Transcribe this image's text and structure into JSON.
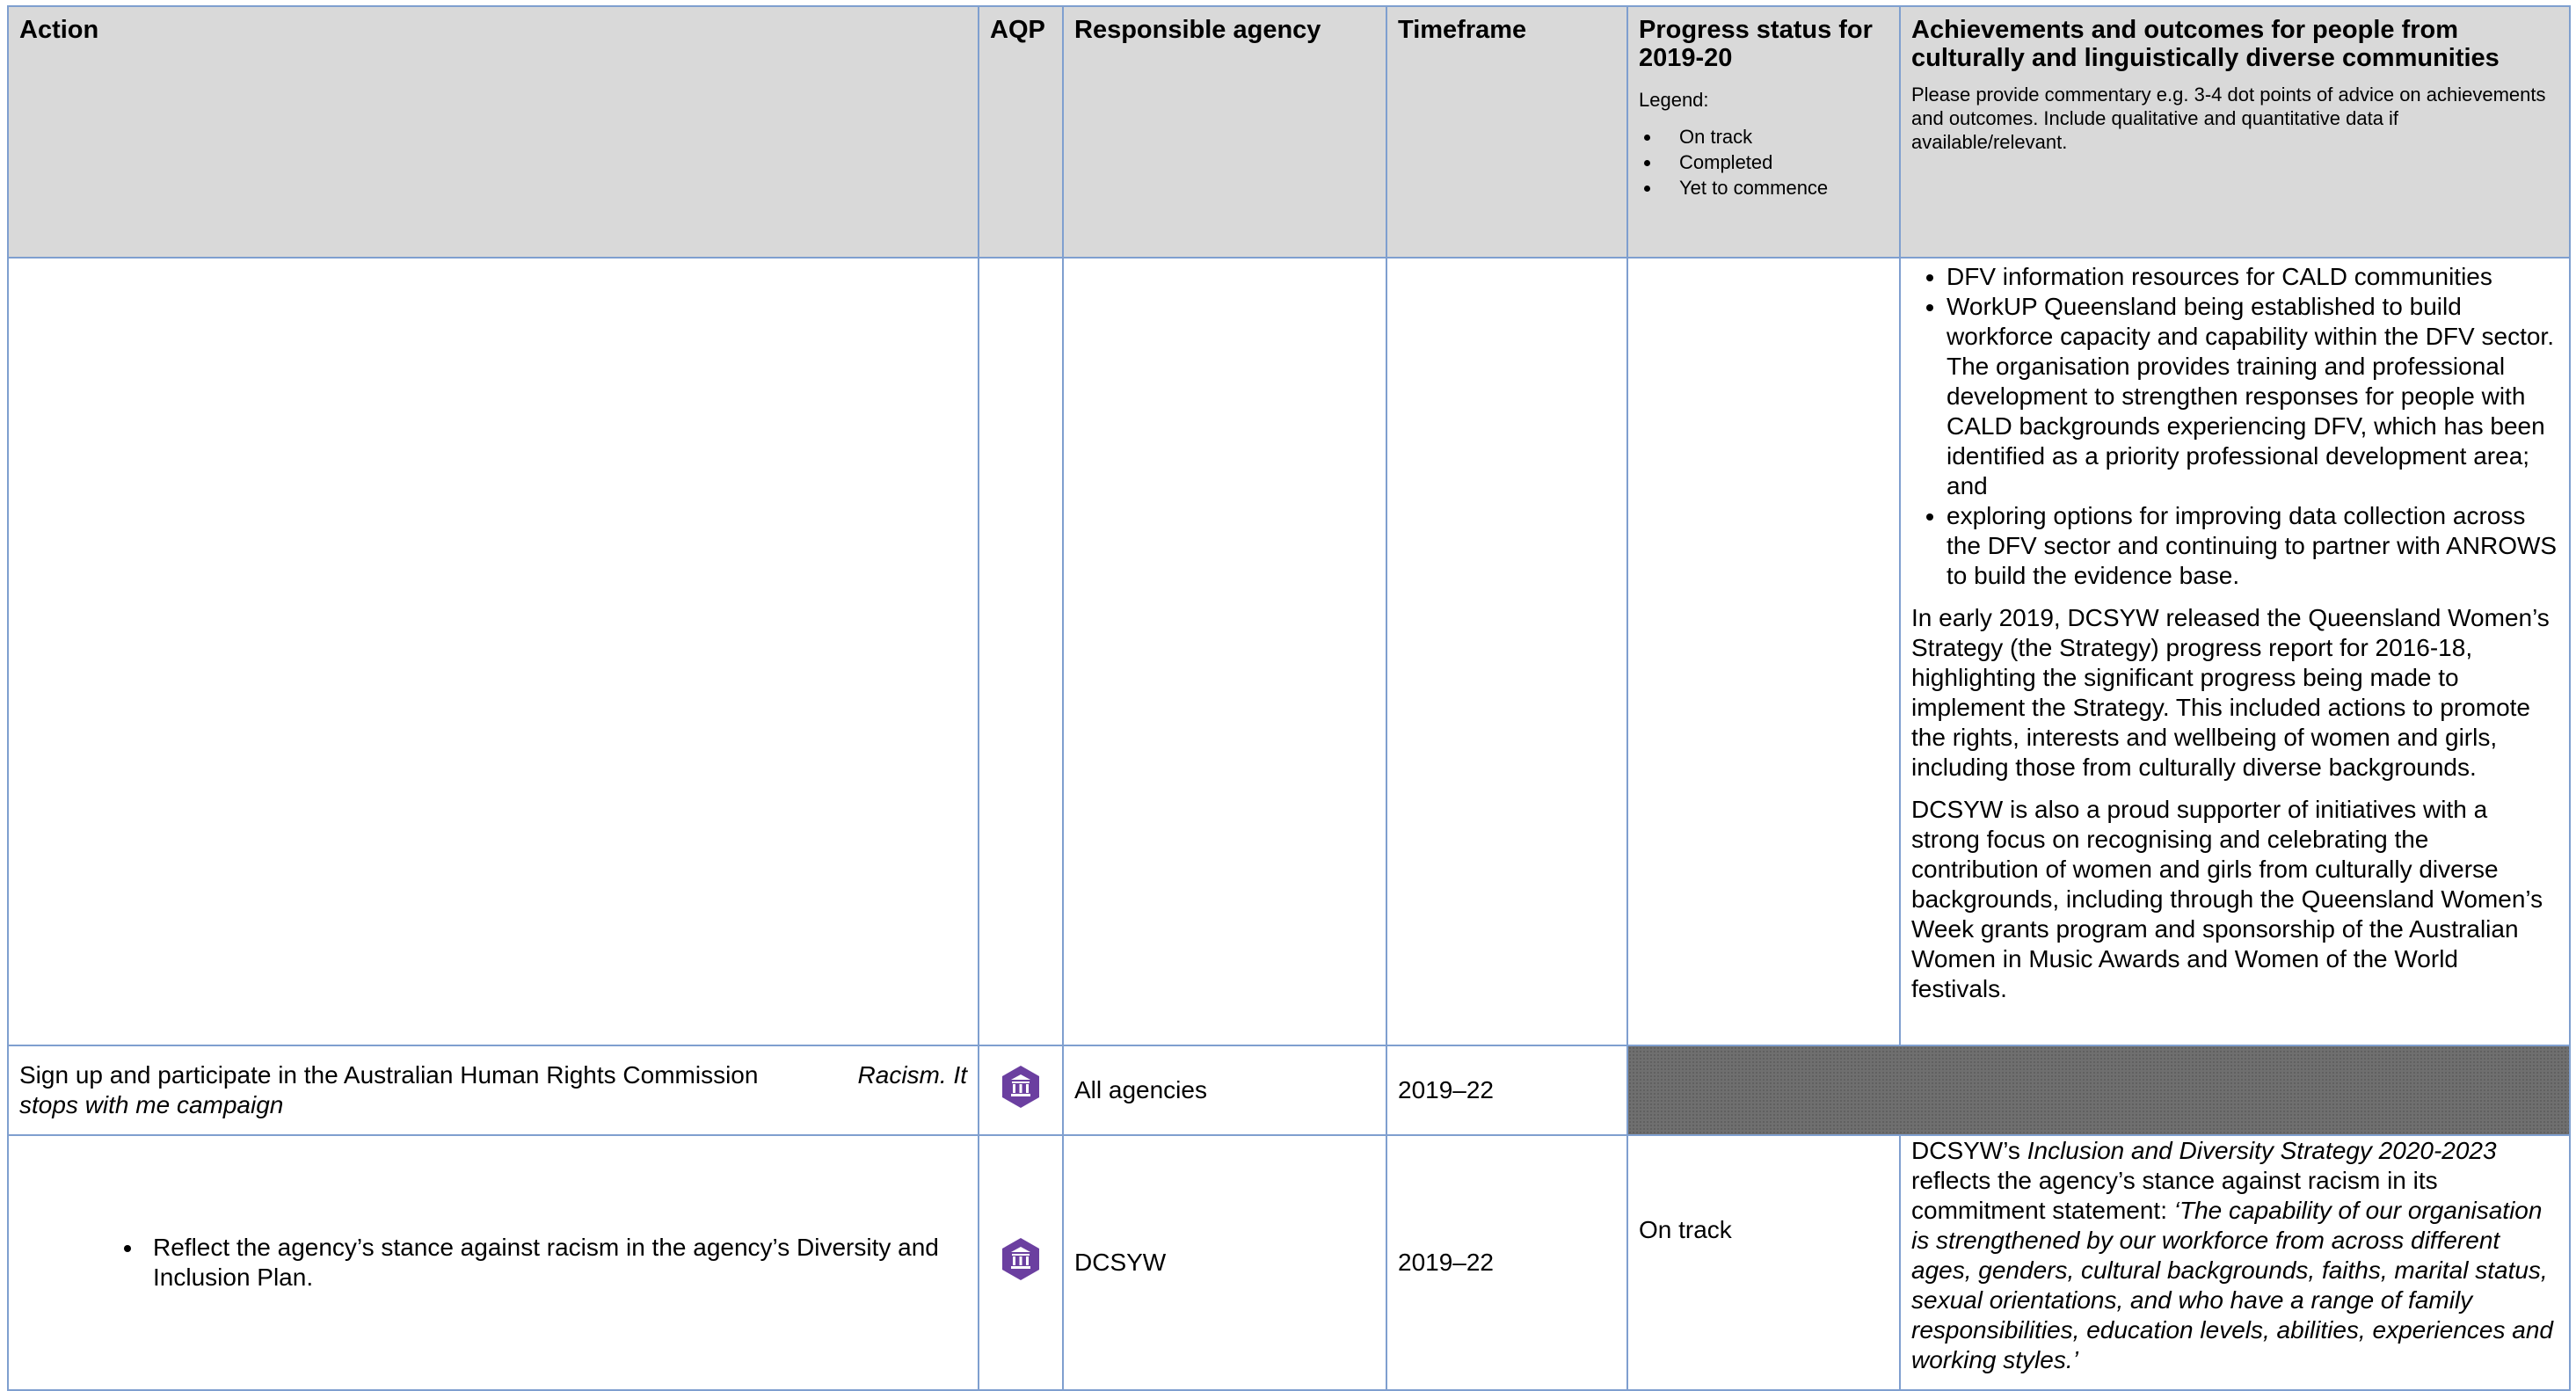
{
  "header": {
    "action": "Action",
    "aqp": "AQP",
    "responsible_agency": "Responsible agency",
    "timeframe": "Timeframe",
    "progress_title": "Progress status for 2019-20",
    "legend_label": "Legend:",
    "legend_items": [
      "On track",
      "Completed",
      "Yet to commence"
    ],
    "achievements_title": "Achievements and outcomes for people from culturally and linguistically diverse communities",
    "achievements_note": "Please provide commentary e.g. 3-4 dot points of advice on achievements and outcomes. Include qualitative and quantitative data if available/relevant."
  },
  "row1": {
    "bullets": [
      "DFV information resources for CALD communities",
      "WorkUP Queensland being established to build workforce capacity and capability within the DFV sector. The organisation provides training and professional development to strengthen responses for people with CALD backgrounds experiencing DFV, which has been identified as a priority professional development area; and",
      "exploring options for improving data collection across the DFV sector and continuing to partner with ANROWS to build the evidence base."
    ],
    "para1": "In early 2019, DCSYW released the Queensland Women’s Strategy (the Strategy) progress report for 2016-18, highlighting the significant progress being made to implement the Strategy. This included actions to promote the rights, interests and wellbeing of women and girls, including those from culturally diverse backgrounds.",
    "para2": "DCSYW is also a proud supporter of initiatives with a strong focus on recognising and celebrating the contribution of women and girls from culturally diverse backgrounds, including through the Queensland Women’s Week grants program and sponsorship of the Australian Women in Music Awards and Women of the World festivals."
  },
  "row2": {
    "action_text": "Sign up and participate in the Australian Human Rights Commission",
    "action_italic_1": "Racism",
    "action_italic_2": ". It",
    "action_italic_3": "stops with me campaign",
    "aqp_icon": "institution-icon",
    "agency": "All agencies",
    "timeframe": "2019–22"
  },
  "row3": {
    "action_bullet": "Reflect the agency’s stance against racism in the agency’s Diversity and Inclusion Plan.",
    "aqp_icon": "institution-icon",
    "agency": "DCSYW",
    "timeframe": "2019–22",
    "progress": "On track",
    "ach_lead": "DCSYW’s ",
    "ach_italic_title": "Inclusion and Diversity Strategy 2020-2023",
    "ach_middle": " reflects the agency’s stance against racism in its commitment statement: ",
    "ach_quote": "‘The capability of our organisation is strengthened by our workforce from across different ages, genders, cultural backgrounds, faiths, marital status, sexual orientations, and who have a range of family responsibilities, education levels, abilities, experiences and working styles.’"
  },
  "colors": {
    "border": "#7f9fcf",
    "header_bg": "#d9d9d9",
    "icon": "#6b3fa0",
    "grey_cell": "#6f6f6f"
  }
}
